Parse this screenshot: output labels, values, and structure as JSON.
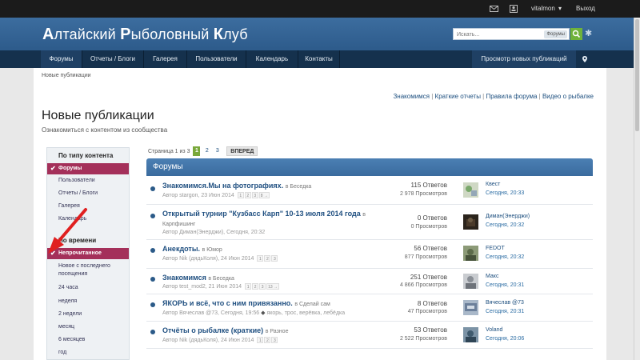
{
  "userbar": {
    "username": "vitalmon",
    "logout": "Выход",
    "mail_icon": "envelope-icon",
    "alerts_icon": "user-card-icon"
  },
  "header": {
    "logo_parts": [
      "А",
      "лтайский ",
      "Р",
      "ыболовный ",
      "К",
      "луб"
    ],
    "search_placeholder": "Искать...",
    "search_scope": "Форумы"
  },
  "nav": {
    "tabs": [
      "Форумы",
      "Отчеты / Блоги",
      "Галерея",
      "Пользователи",
      "Календарь",
      "Контакты"
    ],
    "right": "Просмотр новых публикаций"
  },
  "breadcrumb": "Новые публикации",
  "quick_links": [
    "Знакомимся",
    "Краткие отчеты",
    "Правила форума",
    "Видео о рыбалке"
  ],
  "page_title": "Новые публикации",
  "page_subtitle": "Ознакомиться с контентом из сообщества",
  "sidebar": {
    "content_type_header": "По типу контента",
    "content_types": [
      "Форумы",
      "Пользователи",
      "Отчеты / Блоги",
      "Галерея",
      "Календарь"
    ],
    "time_header": "По времени",
    "time_filters": [
      "Непрочитанное",
      "Новое с последнего посещения",
      "24 часа",
      "неделя",
      "2 недели",
      "месяц",
      "6 месяцев",
      "год"
    ]
  },
  "pager": {
    "label": "Страница 1 из 3",
    "pages": [
      "1",
      "2",
      "3"
    ],
    "next": "ВПЕРЕД"
  },
  "section_title": "Форумы",
  "topics": [
    {
      "title": "Знакомимся.Мы на фотографиях.",
      "forum": "в Беседка",
      "meta": "Автор stargon, 23 Июн 2014",
      "pages": [
        "1",
        "2",
        "3",
        "8 →"
      ],
      "replies": "115 Ответов",
      "views": "2 978 Просмотров",
      "last_user": "Квест",
      "last_time": "Сегодня, 20:33",
      "avatar_color": "#7aa86b"
    },
    {
      "title": "Открытый турнир \"Кузбасс Карп\" 10-13 июля 2014 года",
      "forum": "в Карпфишинг",
      "meta": "Автор Диман(Энерджи), Сегодня, 20:32",
      "pages": [],
      "replies": "0 Ответов",
      "views": "0 Просмотров",
      "last_user": "Диман(Энерджи)",
      "last_time": "Сегодня, 20:32",
      "avatar_color": "#4a3a2a"
    },
    {
      "title": "Анекдоты.",
      "forum": "в Юмор",
      "meta": "Автор Nik (дядьКоля), 24 Июн 2014",
      "pages": [
        "1",
        "2",
        "3"
      ],
      "replies": "56 Ответов",
      "views": "877 Просмотров",
      "last_user": "FEDOT",
      "last_time": "Сегодня, 20:32",
      "avatar_color": "#5c6b4a"
    },
    {
      "title": "Знакомимся",
      "forum": "в Беседка",
      "meta": "Автор test_mod2, 21 Июн 2014",
      "pages": [
        "1",
        "2",
        "3",
        "13 →"
      ],
      "replies": "251 Ответов",
      "views": "4 866 Просмотров",
      "last_user": "Макс",
      "last_time": "Сегодня, 20:31",
      "avatar_color": "#8a8f96"
    },
    {
      "title": "ЯКОРЬ и всё, что с ним привязанно.",
      "forum": "в Сделай сам",
      "meta": "Автор Вячеслав @73, Сегодня, 19:56",
      "tags": "якорь, трос, верёвка, лебёдка",
      "pages": [],
      "replies": "8 Ответов",
      "views": "47 Просмотров",
      "last_user": "Вячеслав @73",
      "last_time": "Сегодня, 20:31",
      "avatar_color": "#6b7f9a"
    },
    {
      "title": "Отчёты о рыбалке (краткие)",
      "forum": "в Разное",
      "meta": "Автор Nik (дядьКоля), 24 Июн 2014",
      "pages": [
        "1",
        "2",
        "3"
      ],
      "replies": "53 Ответов",
      "views": "2 522 Просмотров",
      "last_user": "Voland",
      "last_time": "Сегодня, 20:06",
      "avatar_color": "#3f5a6e"
    }
  ],
  "annotation": {
    "arrow_color": "#e02020"
  }
}
